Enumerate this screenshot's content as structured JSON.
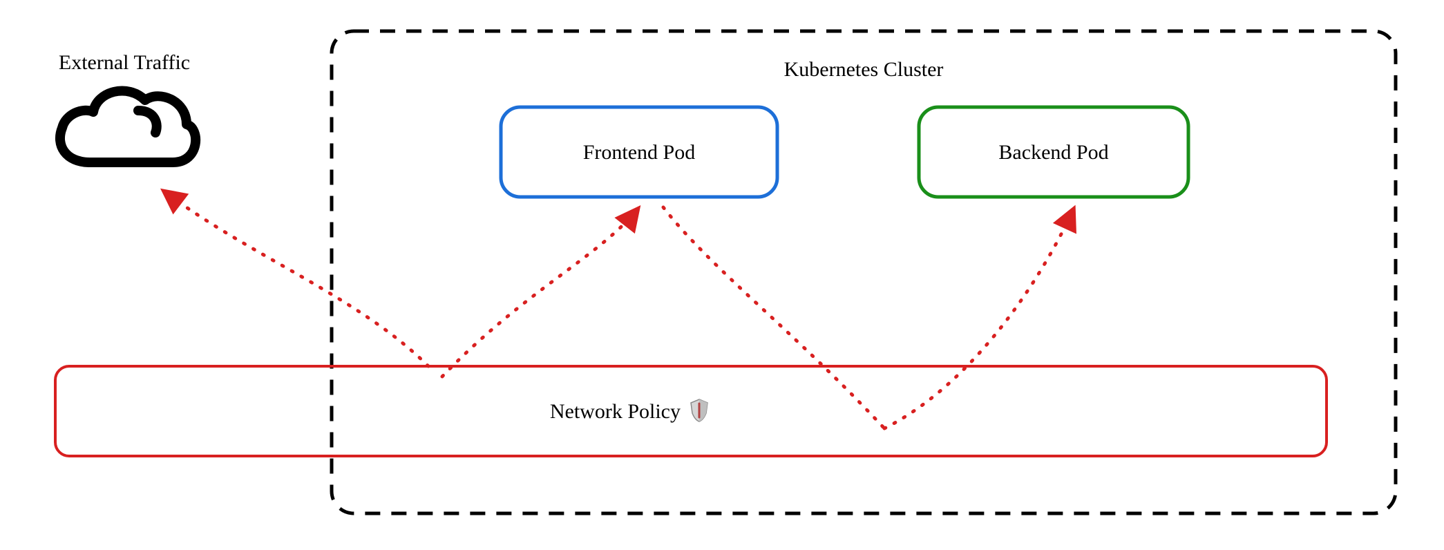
{
  "external_traffic_label": "External Traffic",
  "cluster": {
    "title": "Kubernetes Cluster",
    "pods": {
      "frontend": {
        "label": "Frontend Pod",
        "color": "#1d6fd8"
      },
      "backend": {
        "label": "Backend Pod",
        "color": "#1a8f1a"
      }
    }
  },
  "network_policy": {
    "label": "Network Policy",
    "icon": "shield-icon",
    "color": "#d82020"
  },
  "arrows": {
    "color": "#d82020",
    "style": "dotted",
    "targets": [
      "external-traffic",
      "frontend-pod",
      "backend-pod"
    ],
    "source": "network-policy"
  }
}
